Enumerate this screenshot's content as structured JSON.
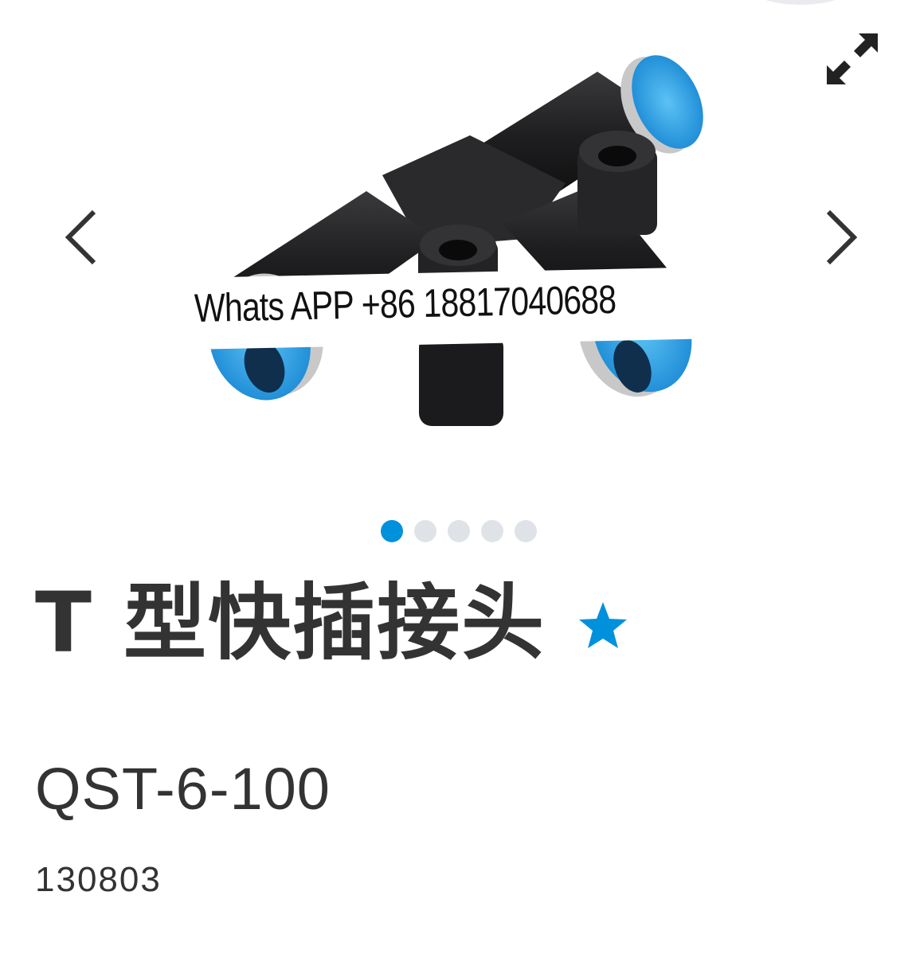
{
  "gallery": {
    "watermark": "Whats APP +86 18817040688",
    "image_alt": "T-piece push-in fitting",
    "slide_count": 5,
    "active_slide": 1,
    "icons": {
      "prev": "chevron-left-icon",
      "next": "chevron-right-icon",
      "expand": "expand-arrows-icon"
    }
  },
  "product": {
    "title": "T 型快插接头",
    "model": "QST-6-100",
    "part_number": "130803",
    "favorite_icon": "star-icon"
  },
  "colors": {
    "accent": "#0091dc",
    "text": "#333333",
    "dot_inactive": "#dfe3e8",
    "fitting_blue": "#1d9be3",
    "fitting_black": "#1a1a1a"
  }
}
